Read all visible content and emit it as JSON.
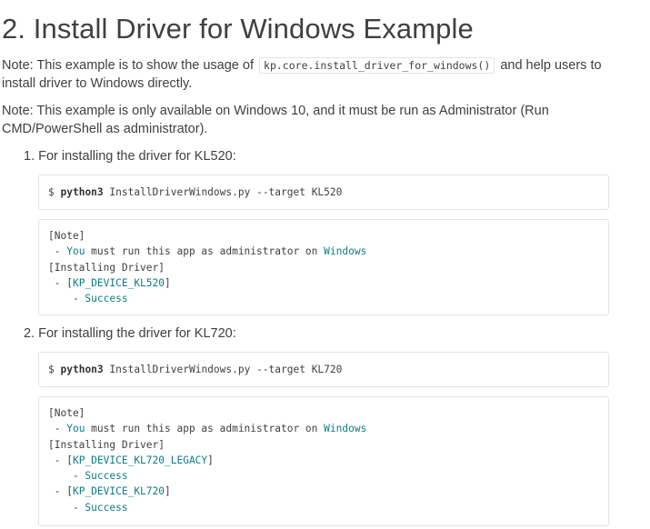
{
  "heading": "2. Install Driver for Windows Example",
  "note1": {
    "prefix": "Note: This example is to show the usage of",
    "code": "kp.core.install_driver_for_windows()",
    "suffix": "and help users to install driver to Windows directly."
  },
  "note2": "Note: This example is only available on Windows 10, and it must be run as Administrator (Run CMD/PowerShell as administrator).",
  "steps": [
    {
      "label": "1. For installing the driver for KL520:",
      "command": {
        "prompt": "$",
        "program": "python3",
        "script": "InstallDriverWindows.py",
        "args": "--target KL520"
      },
      "output": {
        "note_header": "[Note]",
        "note_dash": " - ",
        "note_you": "You",
        "note_mid": " must run this app as administrator ",
        "note_on": "on",
        "note_win": "Windows",
        "install_header": "[Installing Driver]",
        "entries": [
          {
            "dash": " - ",
            "open": "[",
            "device": "KP_DEVICE_KL520",
            "close": "]",
            "result_dash": "    - ",
            "result": "Success"
          }
        ]
      }
    },
    {
      "label": "2. For installing the driver for KL720:",
      "command": {
        "prompt": "$",
        "program": "python3",
        "script": "InstallDriverWindows.py",
        "args": "--target KL720"
      },
      "output": {
        "note_header": "[Note]",
        "note_dash": " - ",
        "note_you": "You",
        "note_mid": " must run this app as administrator ",
        "note_on": "on",
        "note_win": "Windows",
        "install_header": "[Installing Driver]",
        "entries": [
          {
            "dash": " - ",
            "open": "[",
            "device": "KP_DEVICE_KL720_LEGACY",
            "close": "]",
            "result_dash": "    - ",
            "result": "Success"
          },
          {
            "dash": " - ",
            "open": "[",
            "device": "KP_DEVICE_KL720",
            "close": "]",
            "result_dash": "    - ",
            "result": "Success"
          }
        ]
      }
    }
  ]
}
